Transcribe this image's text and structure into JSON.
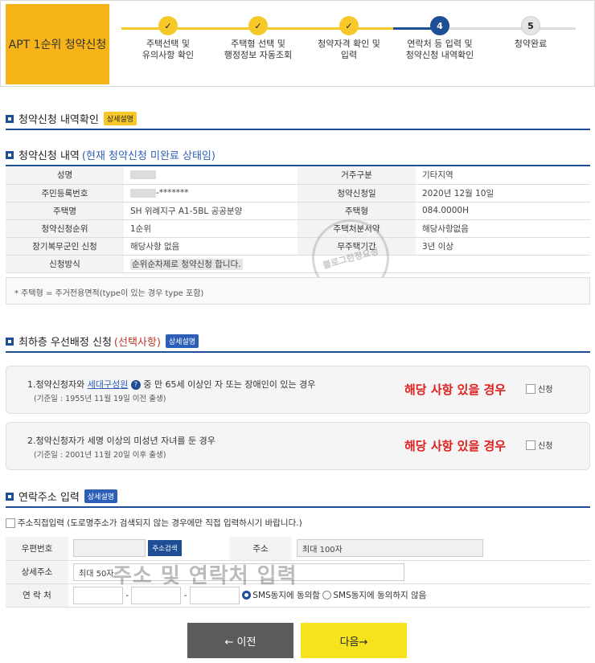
{
  "header": {
    "apt_title": "APT 1순위 청약신청",
    "steps": [
      {
        "num": "",
        "label": "주택선택 및\n유의사항 확인",
        "state": "done"
      },
      {
        "num": "",
        "label": "주택형 선택 및\n행정정보 자동조회",
        "state": "done"
      },
      {
        "num": "",
        "label": "청약자격 확인 및\n입력",
        "state": "done"
      },
      {
        "num": "4",
        "label": "연락처 등 입력 및\n청약신청 내역확인",
        "state": "current"
      },
      {
        "num": "5",
        "label": "청약완료",
        "state": "todo"
      }
    ]
  },
  "section1": {
    "title": "청약신청 내역확인",
    "badge": "상세설명"
  },
  "section2": {
    "title": "청약신청 내역",
    "subtitle": "(현재 청약신청 미완료 상태임)",
    "rows": [
      {
        "l1": "성명",
        "v1": "",
        "l2": "거주구분",
        "v2": "기타지역"
      },
      {
        "l1": "주민등록번호",
        "v1": "-*******",
        "l2": "청약신청일",
        "v2": "2020년 12월 10일"
      },
      {
        "l1": "주택명",
        "v1": "SH 위례지구 A1-5BL 공공분양",
        "l2": "주택형",
        "v2": "084.0000H"
      },
      {
        "l1": "청약신청순위",
        "v1": "1순위",
        "l2": "주택처분서약",
        "v2": "해당사항없음"
      },
      {
        "l1": "장기복무군인 신청",
        "v1": "해당사항 없음",
        "l2": "무주택기간",
        "v2": "3년 이상"
      }
    ],
    "method_label": "신청방식",
    "method_value": "순위순차제로 청약신청 합니다.",
    "note": "* 주택형 = 주거전용면적(type이 있는 경우 type 포함)",
    "stamp_text": "블로그한정요정"
  },
  "section3": {
    "title": "최하층 우선배정 신청",
    "subtitle": "(선택사항)",
    "badge": "상세설명",
    "box1": {
      "text_a": "1.청약신청자와 ",
      "link": "세대구성원",
      "help_icon": "?",
      "text_b": " 중 만 65세 이상인 자 또는 장애인이 있는 경우",
      "date": "(기준일 : 1955년 11월 19일 이전 출생)",
      "highlight": "해당 사항 있을 경우",
      "check_label": "신청"
    },
    "box2": {
      "text": "2.청약신청자가 세명 이상의 미성년 자녀를 둔 경우",
      "date": "(기준일 : 2001년 11월 20일 이후 출생)",
      "highlight": "해당 사항 있을 경우",
      "check_label": "신청"
    }
  },
  "section4": {
    "title": "연락주소 입력",
    "badge": "상세설명",
    "direct_input": "주소직접입력 (도로명주소가 검색되지 않는 경우에만 직접 입력하시기 바랍니다.)",
    "postal_label": "우편번호",
    "search_btn": "주소검색",
    "addr_label": "주소",
    "addr_placeholder": "최대 100자",
    "detail_label": "상세주소",
    "detail_placeholder": "최대 50자",
    "contact_label": "연 락 처",
    "sms_agree": "SMS동지에 동의함",
    "sms_disagree": "SMS동지에 동의하지 않음",
    "watermark": "주소 및 연락처 입력"
  },
  "buttons": {
    "prev": "← 이전",
    "next": "다음→"
  },
  "colors": {
    "accent": "#1d4e96",
    "yellow": "#f6b418",
    "red": "#e02020"
  }
}
